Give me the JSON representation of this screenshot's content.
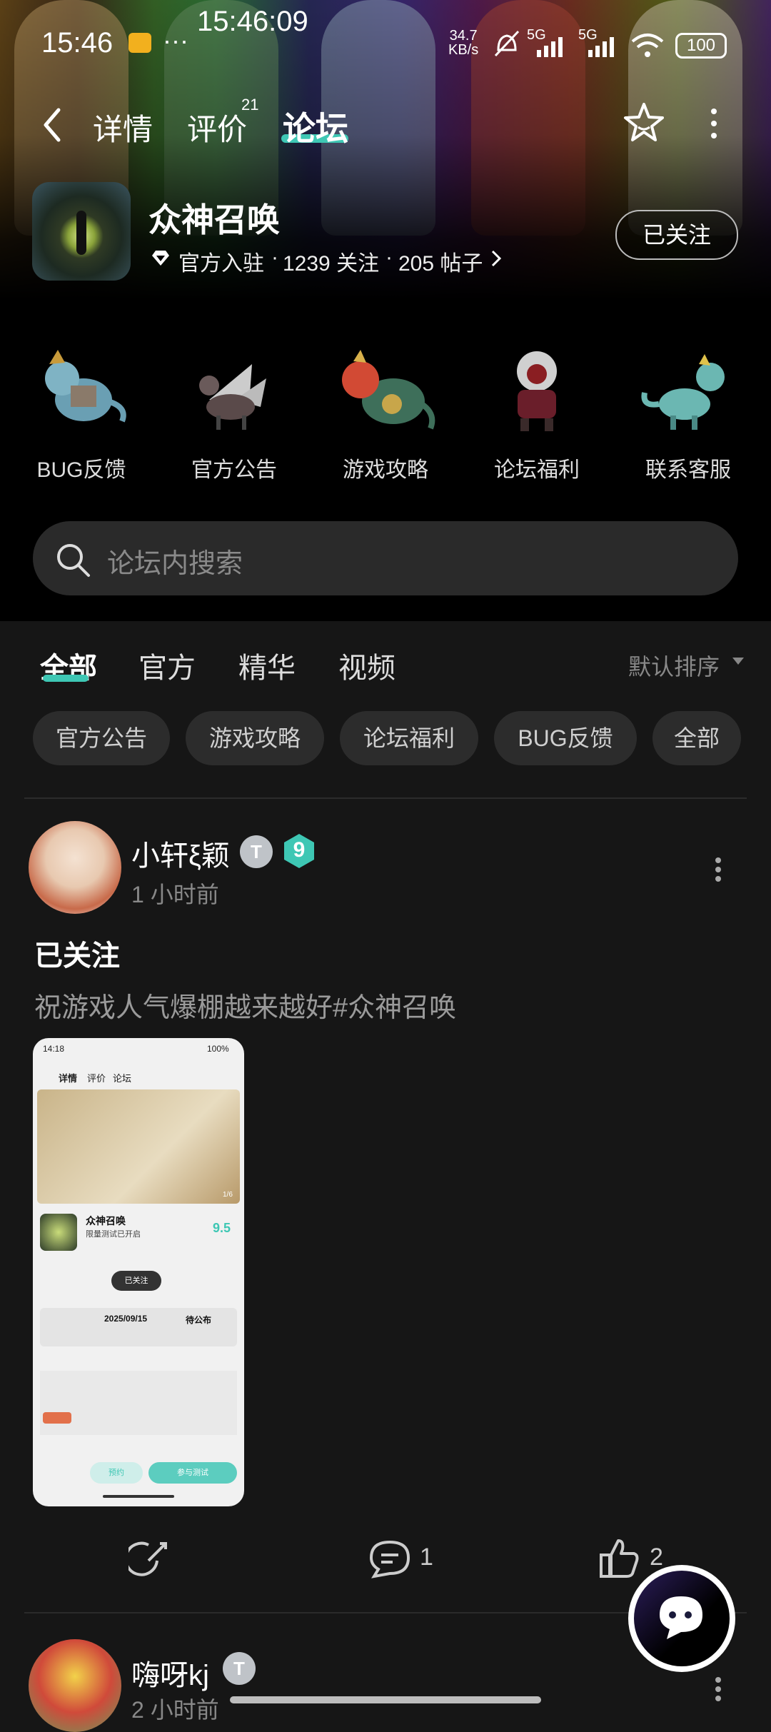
{
  "status": {
    "time": "15:46",
    "clock_overlay": "15:46:09",
    "dots": "···",
    "net_speed_value": "34.7",
    "net_speed_unit": "KB/s",
    "signal1": "5G",
    "signal2": "5G",
    "battery": "100"
  },
  "nav": {
    "tab_detail": "详情",
    "tab_review": "评价",
    "review_count": "21",
    "tab_forum": "论坛"
  },
  "forum": {
    "title": "众神召唤",
    "official_label": "官方入驻",
    "followers": "1239 关注",
    "posts": "205 帖子",
    "follow_button": "已关注",
    "sep": "·"
  },
  "shortcuts": [
    {
      "label": "BUG反馈",
      "icon": "blue-dragon-icon"
    },
    {
      "label": "官方公告",
      "icon": "winged-dragon-icon"
    },
    {
      "label": "游戏攻略",
      "icon": "red-dragon-icon"
    },
    {
      "label": "论坛福利",
      "icon": "armored-beast-icon"
    },
    {
      "label": "联系客服",
      "icon": "teal-dragon-icon"
    }
  ],
  "search": {
    "placeholder": "论坛内搜索"
  },
  "filter_tabs": [
    "全部",
    "官方",
    "精华",
    "视频"
  ],
  "sort_label": "默认排序",
  "chips": [
    "官方公告",
    "游戏攻略",
    "论坛福利",
    "BUG反馈",
    "全部"
  ],
  "posts": [
    {
      "author": "小轩ξ颖",
      "time": "1 小时前",
      "level": "9",
      "title": "已关注",
      "body": "祝游戏人气爆棚越来越好#众神召唤",
      "comments": "1",
      "likes": "2"
    },
    {
      "author": "嗨呀kj",
      "time": "2 小时前"
    }
  ],
  "thumb": {
    "time": "14:18",
    "battery": "100%",
    "tab1": "详情",
    "tab2": "评价",
    "tab3": "论坛",
    "page": "1/6",
    "game": "众神召唤",
    "sub": "限量测试已开启",
    "score": "9.5",
    "toast": "已关注",
    "date": "2025/09/15",
    "pending": "待公布",
    "btn1": "预约",
    "btn2": "参与测试"
  },
  "colors": {
    "accent": "#3ec7b4",
    "bg": "#161616",
    "chip": "#2c2c2c"
  }
}
